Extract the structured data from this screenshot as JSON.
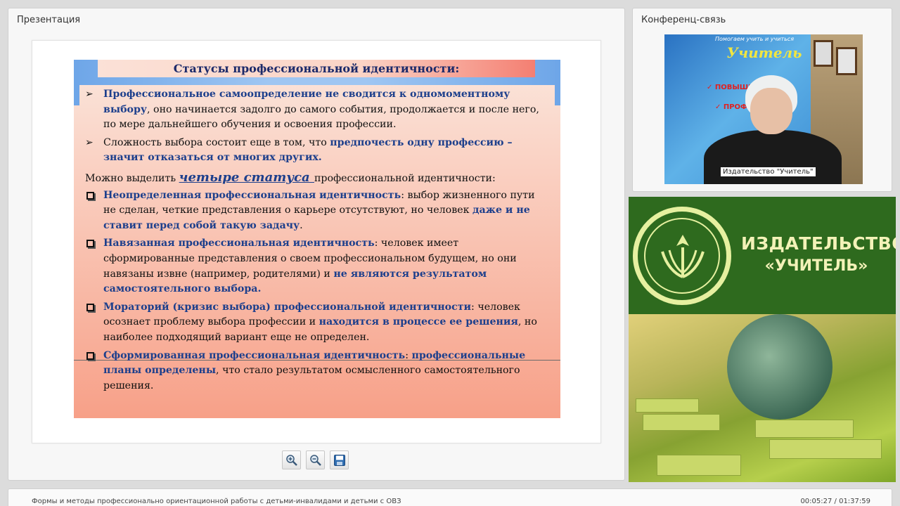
{
  "presentation": {
    "title": "Презентация",
    "slide": {
      "heading": "Статусы профессиональной идентичности:",
      "p1_hl": "Профессиональное самоопределение не сводится к одномоментному выбору",
      "p1_rest": ", оно начинается задолго до самого события, продолжается и после него, по мере дальнейшего обучения и освоения профессии.",
      "p2_a": "Сложность выбора состоит еще в том, что ",
      "p2_hl": "предпочесть одну профессию – значит отказаться от многих других.",
      "p3_a": "Можно выделить ",
      "p3_big": "четыре статуса ",
      "p3_b": "профессиональной идентичности:",
      "s1_hl": "Неопределенная профессиональная идентичность",
      "s1_a": ": выбор жизненного пути не сделан, четкие представления о карьере отсутствуют, но человек ",
      "s1_hl2": "даже и не ставит перед собой такую задачу",
      "s1_b": ".",
      "s2_hl": "Навязанная профессиональная идентичность",
      "s2_a": ": человек имеет сформированные представления о своем профессиональном будущем, но они навязаны извне (например, родителями) и ",
      "s2_hl2": "не являются результатом самостоятельного выбора.",
      "s3_hl": "Мораторий (кризис выбора) профессиональной идентичности",
      "s3_a": ": человек осознает проблему выбора профессии и ",
      "s3_hl2": "находится в процессе ее решения",
      "s3_b": ", но наиболее подходящий вариант еще не определен.",
      "s4_hl": "Сформированная профессиональная идентичность",
      "s4_a": ": ",
      "s4_hl2": "профессиональные планы определены",
      "s4_b": ", что стало результатом осмысленного самостоятельного решения."
    },
    "toolbar": {
      "zoom_in": "zoom-in-icon",
      "zoom_out": "zoom-out-icon",
      "save": "save-icon"
    }
  },
  "conference": {
    "title": "Конференц-связь",
    "video_label": "Издательство \"Учитель\"",
    "bg_small": "Помогаем учить и учиться",
    "bg_logo": "Учитель",
    "bg_check1": "✓ ПОВЫШЕН",
    "bg_check2": "✓ ПРОФЕ"
  },
  "banner": {
    "line1": "ИЗДАТЕЛЬСТВО",
    "line2": "«УЧИТЕЛЬ»"
  },
  "footer": {
    "title": "Формы и методы профессионально ориентационной работы с детьми-инвалидами и детьми с ОВЗ",
    "time": "00:05:27 / 01:37:59"
  },
  "colors": {
    "accent_blue": "#1d3f8c",
    "banner_green": "#2e6a1e"
  }
}
